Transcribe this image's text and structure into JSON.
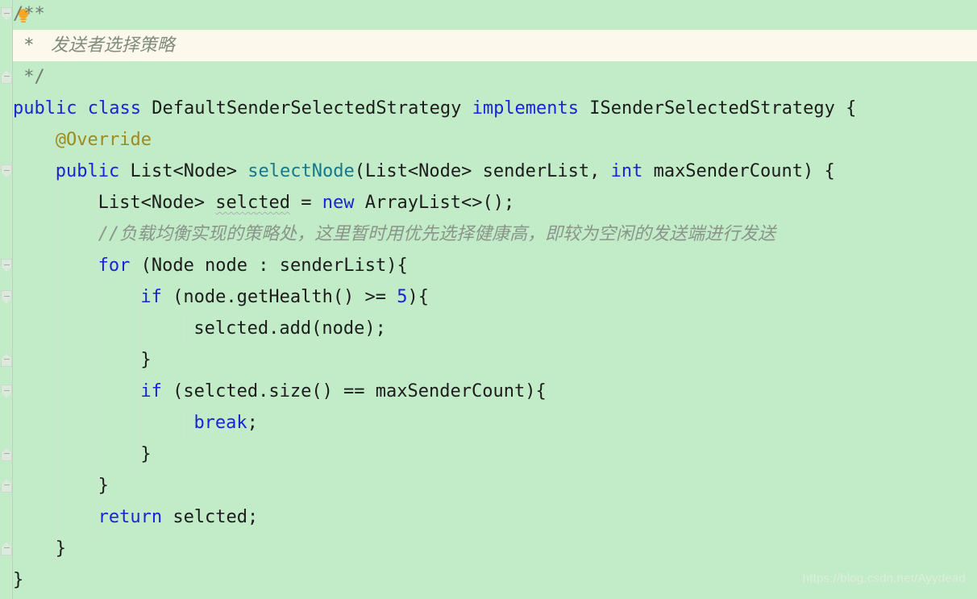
{
  "editor": {
    "language": "java",
    "background_color": "#C2EBC8",
    "current_line_color": "#FCF8EB",
    "gutter_color": "#C2EBC8",
    "keyword_color": "#1924D8",
    "annotation_color": "#9E8A1E",
    "method_color": "#16788C",
    "comment_color": "#8A958A",
    "text_color": "#1C1C1C",
    "indent_guide_color": "#D5E3D5"
  },
  "icons": {
    "intention_bulb": "lightbulb-icon",
    "fold_open": "fold-collapse-icon",
    "fold_close": "fold-expand-icon"
  },
  "lines": [
    {
      "n": 1,
      "indent": 0,
      "highlighted": false,
      "parts": [
        {
          "t": "/**",
          "c": "docstar"
        }
      ]
    },
    {
      "n": 2,
      "indent": 0,
      "highlighted": true,
      "parts": [
        {
          "t": " * ",
          "c": "docstar"
        },
        {
          "t": " 发送者选择策略",
          "c": "doc"
        }
      ]
    },
    {
      "n": 3,
      "indent": 0,
      "highlighted": false,
      "parts": [
        {
          "t": " */",
          "c": "docstar"
        }
      ]
    },
    {
      "n": 4,
      "indent": 0,
      "highlighted": false,
      "parts": [
        {
          "t": "public",
          "c": "kw"
        },
        {
          "t": " ",
          "c": ""
        },
        {
          "t": "class",
          "c": "kw"
        },
        {
          "t": " DefaultSenderSelectedStrategy ",
          "c": ""
        },
        {
          "t": "implements",
          "c": "kw"
        },
        {
          "t": " ISenderSelectedStrategy {",
          "c": ""
        }
      ]
    },
    {
      "n": 5,
      "indent": 1,
      "highlighted": false,
      "parts": [
        {
          "t": "@Override",
          "c": "anno"
        }
      ]
    },
    {
      "n": 6,
      "indent": 1,
      "highlighted": false,
      "parts": [
        {
          "t": "public",
          "c": "kw"
        },
        {
          "t": " List<Node> ",
          "c": ""
        },
        {
          "t": "selectNode",
          "c": "method"
        },
        {
          "t": "(List<Node> senderList, ",
          "c": ""
        },
        {
          "t": "int",
          "c": "kw"
        },
        {
          "t": " maxSenderCount) {",
          "c": ""
        }
      ]
    },
    {
      "n": 7,
      "indent": 2,
      "highlighted": false,
      "parts": [
        {
          "t": "List<Node> ",
          "c": ""
        },
        {
          "t": "selcted",
          "c": "typo"
        },
        {
          "t": " = ",
          "c": ""
        },
        {
          "t": "new",
          "c": "kw"
        },
        {
          "t": " ArrayList<>();",
          "c": ""
        }
      ]
    },
    {
      "n": 8,
      "indent": 2,
      "highlighted": false,
      "parts": [
        {
          "t": "//",
          "c": "cmtslash"
        },
        {
          "t": "负载均衡实现的策略处，这里暂时用优先选择健康高，即较为空闲的发送端进行发送",
          "c": "cmt"
        }
      ]
    },
    {
      "n": 9,
      "indent": 2,
      "highlighted": false,
      "parts": [
        {
          "t": "for",
          "c": "kw"
        },
        {
          "t": " (Node node : senderList){",
          "c": ""
        }
      ]
    },
    {
      "n": 10,
      "indent": 3,
      "highlighted": false,
      "parts": [
        {
          "t": "if",
          "c": "kw"
        },
        {
          "t": " (node.getHealth() >= ",
          "c": ""
        },
        {
          "t": "5",
          "c": "num"
        },
        {
          "t": "){",
          "c": ""
        }
      ]
    },
    {
      "n": 11,
      "indent": 4,
      "highlighted": false,
      "parts": [
        {
          "t": " selcted.add(node);",
          "c": ""
        }
      ]
    },
    {
      "n": 12,
      "indent": 3,
      "highlighted": false,
      "parts": [
        {
          "t": "}",
          "c": ""
        }
      ]
    },
    {
      "n": 13,
      "indent": 3,
      "highlighted": false,
      "parts": [
        {
          "t": "if",
          "c": "kw"
        },
        {
          "t": " (selcted.size() == maxSenderCount){",
          "c": ""
        }
      ]
    },
    {
      "n": 14,
      "indent": 4,
      "highlighted": false,
      "parts": [
        {
          "t": " ",
          "c": ""
        },
        {
          "t": "break",
          "c": "kw"
        },
        {
          "t": ";",
          "c": ""
        }
      ]
    },
    {
      "n": 15,
      "indent": 3,
      "highlighted": false,
      "parts": [
        {
          "t": "}",
          "c": ""
        }
      ]
    },
    {
      "n": 16,
      "indent": 2,
      "highlighted": false,
      "parts": [
        {
          "t": "}",
          "c": ""
        }
      ]
    },
    {
      "n": 17,
      "indent": 2,
      "highlighted": false,
      "parts": [
        {
          "t": "return",
          "c": "kw"
        },
        {
          "t": " selcted;",
          "c": ""
        }
      ]
    },
    {
      "n": 18,
      "indent": 1,
      "highlighted": false,
      "parts": [
        {
          "t": "}",
          "c": ""
        }
      ]
    },
    {
      "n": 19,
      "indent": 0,
      "highlighted": false,
      "parts": [
        {
          "t": "}",
          "c": ""
        }
      ]
    }
  ],
  "fold_markers": [
    {
      "line": 1,
      "type": "open"
    },
    {
      "line": 3,
      "type": "close"
    },
    {
      "line": 6,
      "type": "open"
    },
    {
      "line": 9,
      "type": "open"
    },
    {
      "line": 10,
      "type": "open"
    },
    {
      "line": 12,
      "type": "close"
    },
    {
      "line": 13,
      "type": "open"
    },
    {
      "line": 15,
      "type": "close"
    },
    {
      "line": 16,
      "type": "close"
    },
    {
      "line": 18,
      "type": "close"
    }
  ],
  "indent_guides": [
    {
      "col": 1,
      "from_line": 5,
      "to_line": 18
    },
    {
      "col": 2,
      "from_line": 7,
      "to_line": 17
    },
    {
      "col": 3,
      "from_line": 10,
      "to_line": 15
    },
    {
      "col": 4,
      "from_line": 11,
      "to_line": 11
    },
    {
      "col": 4,
      "from_line": 14,
      "to_line": 14
    }
  ],
  "watermark": {
    "text": "https://blog.csdn.net/Ayydead"
  }
}
